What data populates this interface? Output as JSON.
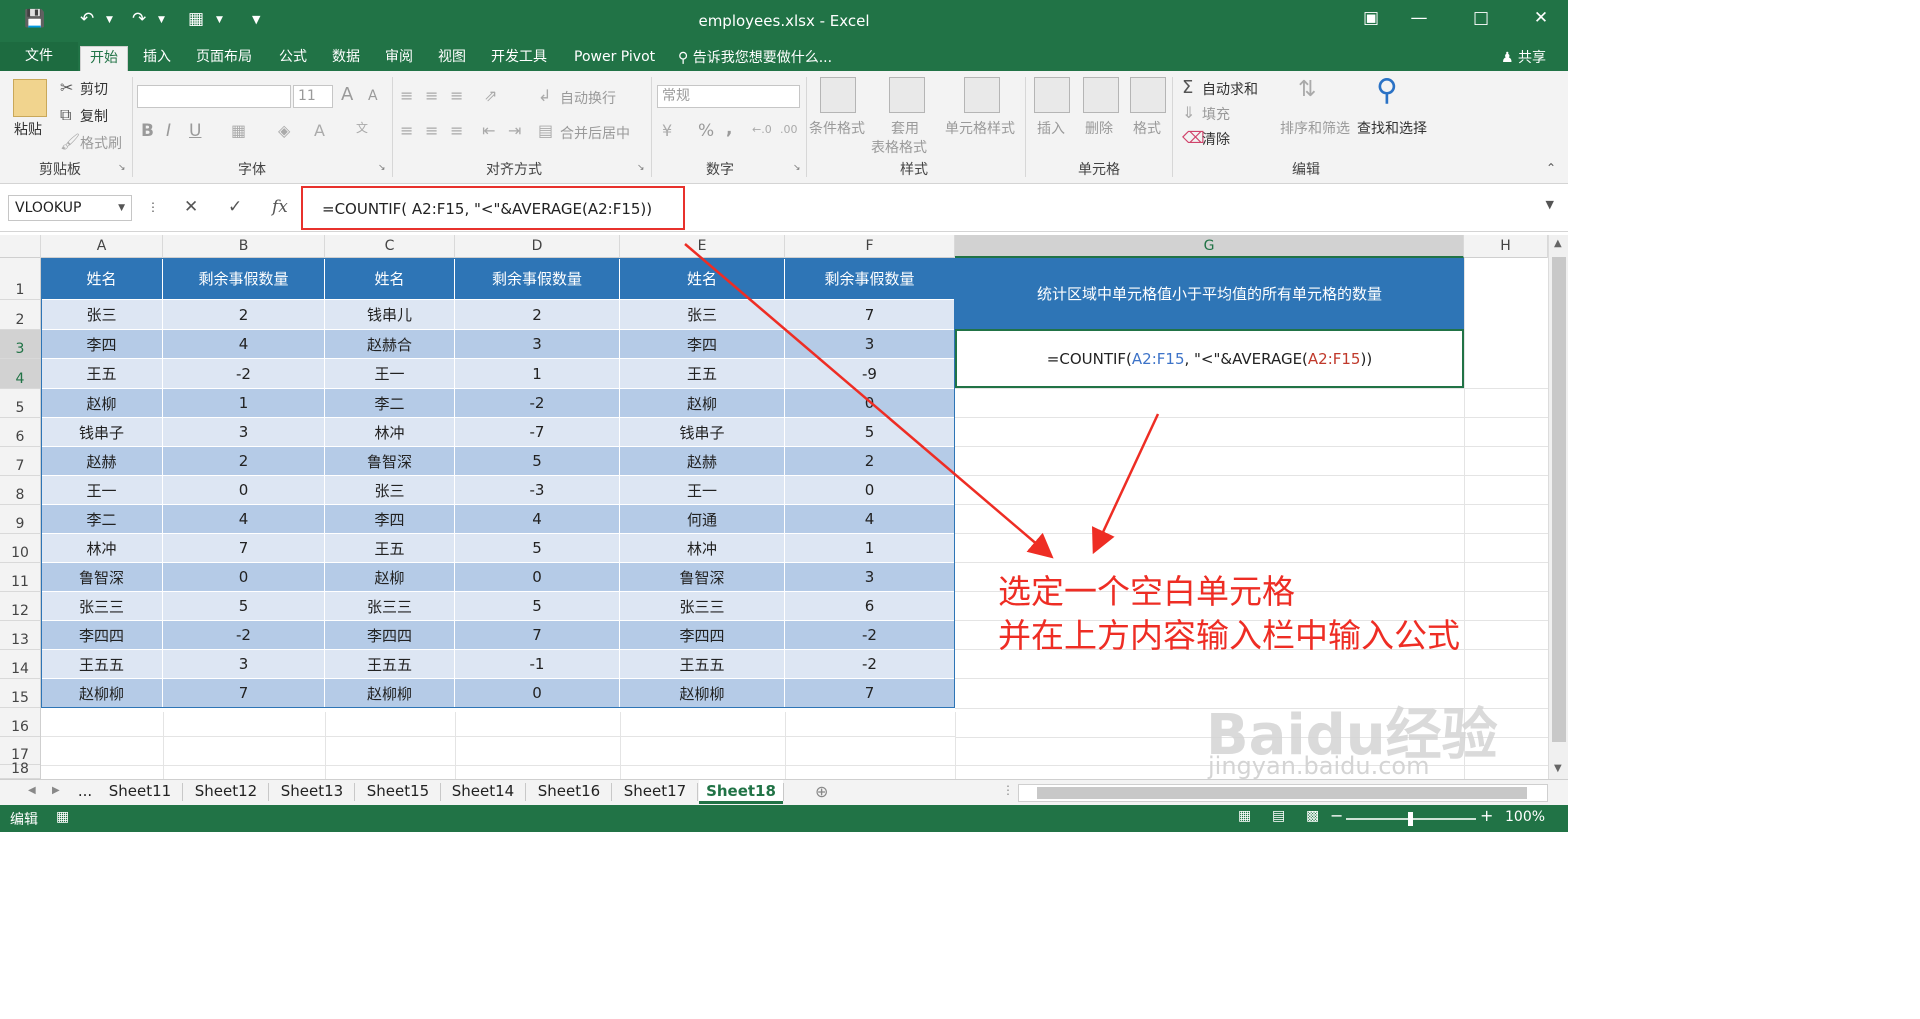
{
  "window": {
    "title": "employees.xlsx - Excel",
    "qat": [
      "save-icon",
      "undo-icon",
      "redo-icon",
      "form-icon",
      "customize-icon"
    ]
  },
  "tabs": [
    "文件",
    "开始",
    "插入",
    "页面布局",
    "公式",
    "数据",
    "审阅",
    "视图",
    "开发工具",
    "Power Pivot"
  ],
  "tell_me": "告诉我您想要做什么...",
  "share": "共享",
  "ribbon": {
    "clipboard": {
      "paste": "粘贴",
      "cut": "剪切",
      "copy": "复制",
      "format_painter": "格式刷",
      "label": "剪贴板"
    },
    "font": {
      "size": "11",
      "label": "字体",
      "grow": "A",
      "shrink": "A",
      "bold": "B",
      "italic": "I",
      "underline": "U"
    },
    "alignment": {
      "wrap": "自动换行",
      "merge": "合并后居中",
      "label": "对齐方式"
    },
    "number": {
      "format": "常规",
      "percent": "%",
      "comma": ",",
      "label": "数字"
    },
    "styles": {
      "conditional": "条件格式",
      "table_line1": "套用",
      "table_line2": "表格格式",
      "cell_styles": "单元格样式",
      "label": "样式"
    },
    "cells": {
      "insert": "插入",
      "delete": "删除",
      "format": "格式",
      "label": "单元格"
    },
    "editing": {
      "autosum": "自动求和",
      "fill": "填充",
      "clear": "清除",
      "sort": "排序和筛选",
      "find": "查找和选择",
      "label": "编辑"
    }
  },
  "formula_bar": {
    "name_box": "VLOOKUP",
    "fx": "fx",
    "formula": "=COUNTIF( A2:F15, \"<\"&AVERAGE(A2:F15))"
  },
  "columns": [
    "A",
    "B",
    "C",
    "D",
    "E",
    "F",
    "G",
    "H"
  ],
  "rows": [
    "1",
    "2",
    "3",
    "4",
    "5",
    "6",
    "7",
    "8",
    "9",
    "10",
    "11",
    "12",
    "13",
    "14",
    "15",
    "16",
    "17",
    "18"
  ],
  "table": {
    "headers": [
      "姓名",
      "剩余事假数量",
      "姓名",
      "剩余事假数量",
      "姓名",
      "剩余事假数量"
    ],
    "rows": [
      [
        "张三",
        "2",
        "钱串儿",
        "2",
        "张三",
        "7"
      ],
      [
        "李四",
        "4",
        "赵赫合",
        "3",
        "李四",
        "3"
      ],
      [
        "王五",
        "-2",
        "王一",
        "1",
        "王五",
        "-9"
      ],
      [
        "赵柳",
        "1",
        "李二",
        "-2",
        "赵柳",
        "0"
      ],
      [
        "钱串子",
        "3",
        "林冲",
        "-7",
        "钱串子",
        "5"
      ],
      [
        "赵赫",
        "2",
        "鲁智深",
        "5",
        "赵赫",
        "2"
      ],
      [
        "王一",
        "0",
        "张三",
        "-3",
        "王一",
        "0"
      ],
      [
        "李二",
        "4",
        "李四",
        "4",
        "何通",
        "4"
      ],
      [
        "林冲",
        "7",
        "王五",
        "5",
        "林冲",
        "1"
      ],
      [
        "鲁智深",
        "0",
        "赵柳",
        "0",
        "鲁智深",
        "3"
      ],
      [
        "张三三",
        "5",
        "张三三",
        "5",
        "张三三",
        "6"
      ],
      [
        "李四四",
        "-2",
        "李四四",
        "7",
        "李四四",
        "-2"
      ],
      [
        "王五五",
        "3",
        "王五五",
        "-1",
        "王五五",
        "-2"
      ],
      [
        "赵柳柳",
        "7",
        "赵柳柳",
        "0",
        "赵柳柳",
        "7"
      ]
    ]
  },
  "g_cell": {
    "header": "统计区域中单元格值小于平均值的所有单元格的数量",
    "formula_parts": [
      "=COUNTIF( ",
      "A2:F15",
      ", \"<\"&AVERAGE(",
      "A2:F15",
      "))"
    ]
  },
  "annotation": {
    "line1": "选定一个空白单元格",
    "line2": "并在上方内容输入栏中输入公式"
  },
  "sheets": [
    "...",
    "Sheet11",
    "Sheet12",
    "Sheet13",
    "Sheet15",
    "Sheet14",
    "Sheet16",
    "Sheet17",
    "Sheet18"
  ],
  "active_sheet": "Sheet18",
  "status": {
    "mode": "编辑",
    "zoom": "100%"
  },
  "watermark": {
    "logo": "Baidu经验",
    "url": "jingyan.baidu.com"
  },
  "colors": {
    "excel_green": "#217346",
    "header_blue": "#2e75b6",
    "row_light": "#dde6f3",
    "row_dark": "#b5cbe7",
    "annotation_red": "#ee2d24"
  }
}
